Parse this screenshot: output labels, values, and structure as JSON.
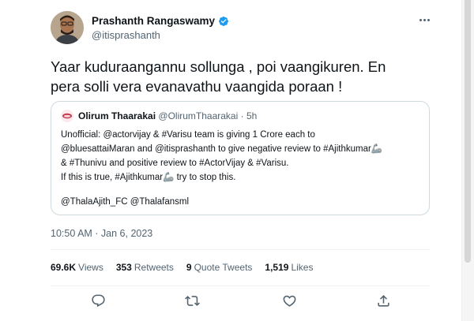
{
  "author": {
    "name": "Prashanth Rangaswamy",
    "handle": "@itisprashanth",
    "verified": true
  },
  "tweet": {
    "text_line1": "Yaar kuduraangannu sollunga , poi vaangikuren. En",
    "text_line2": "pera solli vera evanavathu vaangida poraan !"
  },
  "quote": {
    "name": "Olirum Thaarakai",
    "handle": "@OlirumThaarakai",
    "separator": "·",
    "time": "5h",
    "lines": [
      "Unofficial: @actorvijay & #Varisu team is giving 1 Crore each to",
      "@bluesattaiMaran and @itisprashanth to give negative review to #Ajithkumar🦾",
      "& #Thunivu and positive review to #ActorVijay & #Varisu.",
      "If this is true, #Ajithkumar🦾 try to stop this."
    ],
    "mentions": "@ThalaAjith_FC @Thalafansml"
  },
  "timestamp": "10:50 AM · Jan 6, 2023",
  "stats": {
    "views_count": "69.6K",
    "views_label": "Views",
    "retweets_count": "353",
    "retweets_label": "Retweets",
    "quotes_count": "9",
    "quotes_label": "Quote Tweets",
    "likes_count": "1,519",
    "likes_label": "Likes"
  },
  "actions": {
    "reply_icon": "reply-icon",
    "retweet_icon": "retweet-icon",
    "like_icon": "like-icon",
    "share_icon": "share-icon"
  },
  "colors": {
    "verified": "#1d9bf0",
    "text": "#0f1419",
    "secondary": "#536471",
    "border": "#cfd9de"
  }
}
